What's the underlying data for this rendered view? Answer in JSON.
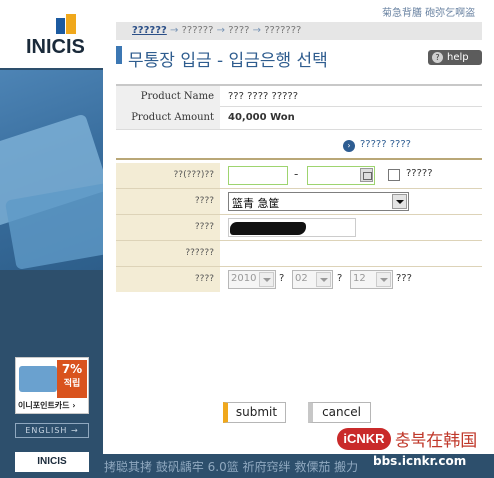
{
  "brand": {
    "logo_text": "INICIS",
    "footer_logo_text": "INICIS"
  },
  "corner_text": "菊急背膳 砲弥乞啊盗",
  "breadcrumb": {
    "current": "??????",
    "steps": [
      "??????",
      "????",
      "???????"
    ],
    "arrow": "→"
  },
  "page": {
    "title": "무통장 입금 - 입금은행 선택"
  },
  "help": {
    "label": "help",
    "icon": "?"
  },
  "product": {
    "name_label": "Product Name",
    "name_value": "??? ???? ?????",
    "amount_label": "Product Amount",
    "amount_value": "40,000 Won"
  },
  "more_link": {
    "label": "????? ????",
    "icon": "›"
  },
  "form": {
    "row1": {
      "label": "??(???)??",
      "dash": "-",
      "checkbox_label": "?????"
    },
    "row2": {
      "label": "????",
      "selected": "篮青 急筐"
    },
    "row3": {
      "label": "????"
    },
    "row4": {
      "label": "??????"
    },
    "row5": {
      "label": "????",
      "year": "2010",
      "month": "02",
      "day": "12",
      "year_suffix": "?",
      "month_suffix": "?",
      "day_suffix": "???"
    }
  },
  "buttons": {
    "submit": "submit",
    "cancel": "cancel"
  },
  "promo": {
    "percent": "7%",
    "sub": "적립",
    "label": "이니포인트카드 ›"
  },
  "english_button": "ENGLISH →",
  "bottom_text": "拷聪其拷 鼓矾龋牢 6.0篮 祈府窍绊 救傈茄 搬力",
  "watermark": {
    "badge": "iCNKR",
    "text": "충북在韩国",
    "url": "bbs.icnkr.com"
  }
}
